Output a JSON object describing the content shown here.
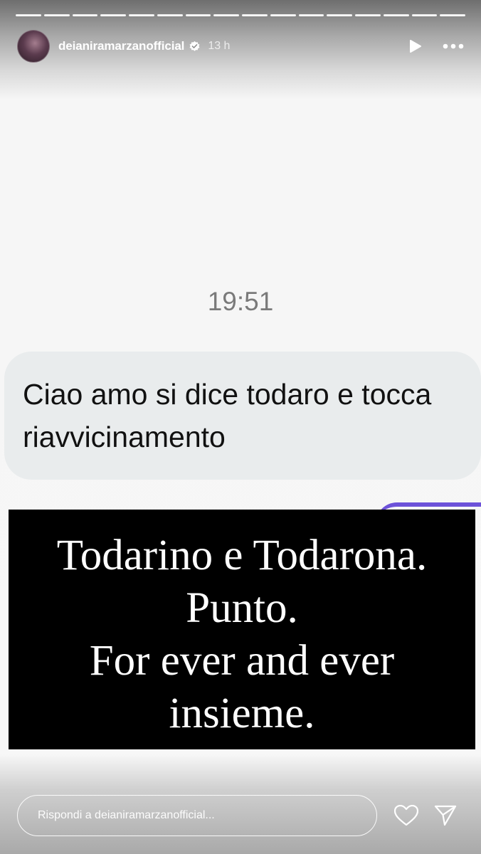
{
  "story": {
    "segment_count": 16,
    "active_segment": 15,
    "header": {
      "username": "deianiramarzanofficial",
      "time_ago": "13 h",
      "icons": [
        "avatar",
        "verified-badge-icon",
        "play-icon",
        "more-icon"
      ]
    },
    "content": {
      "chat_timestamp": "19:51",
      "message_text": "Ciao amo si dice todaro e tocca riavvicinamento",
      "overlay_text": "Todarino e Todarona.\nPunto.\nFor ever and ever\ninsieme."
    },
    "footer": {
      "reply_placeholder": "Rispondi a deianiramarzanofficial...",
      "icons": [
        "heart-icon",
        "send-icon"
      ]
    }
  },
  "colors": {
    "accent_purple": "#6d52d9",
    "bubble_bg": "#e9eced",
    "overlay_bg": "#000000"
  }
}
